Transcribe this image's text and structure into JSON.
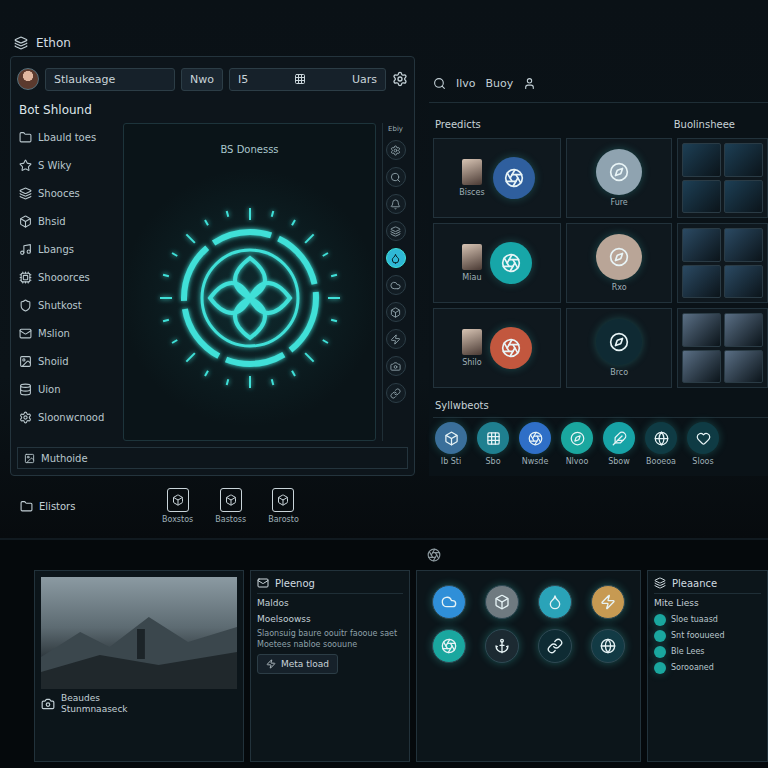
{
  "window": {
    "title": "Ethon"
  },
  "profile": {
    "name": "Stlaukeage",
    "button": "Nwo",
    "field": "I5",
    "user": "Uars"
  },
  "panel": {
    "title": "Bot Shlound",
    "badge": "BS Donesss",
    "status": "Muthoide"
  },
  "sidebar": {
    "items": [
      {
        "label": "Lbauld toes",
        "selected": false
      },
      {
        "label": "S Wiky",
        "selected": false
      },
      {
        "label": "Shooces",
        "selected": false
      },
      {
        "label": "Bhsid",
        "selected": false
      },
      {
        "label": "Lbangs",
        "selected": false
      },
      {
        "label": "Shooorces",
        "selected": false
      },
      {
        "label": "Shutkost",
        "selected": false
      },
      {
        "label": "Mslion",
        "selected": false
      },
      {
        "label": "Shoiid",
        "selected": false
      },
      {
        "label": "Uion",
        "selected": false
      },
      {
        "label": "Sloonwcnood",
        "selected": false
      }
    ]
  },
  "tool_strip": {
    "label": "Ebiy",
    "items": [
      {
        "selected": false
      },
      {
        "selected": false
      },
      {
        "selected": false
      },
      {
        "selected": false
      },
      {
        "selected": true
      },
      {
        "selected": false
      },
      {
        "selected": false
      },
      {
        "selected": false
      },
      {
        "selected": false
      },
      {
        "selected": false
      }
    ]
  },
  "launcher": {
    "title": "Elistors",
    "items": [
      "Boxstos",
      "Bastoss",
      "Barosto"
    ]
  },
  "topbar": {
    "items": [
      "Ilvo",
      "Buoy"
    ]
  },
  "sections": {
    "left": "Preedicts",
    "right": "Buolinsheee"
  },
  "cards": [
    {
      "kind": "thumb-circle",
      "label": "Bisces",
      "color": "#2f5f9e"
    },
    {
      "kind": "circle",
      "label": "Fure",
      "color": "#8fa3b0"
    },
    {
      "kind": "gallery",
      "color": "#1d3f55"
    },
    {
      "kind": "thumb-circle",
      "label": "Miau",
      "color": "#17a6a8"
    },
    {
      "kind": "circle",
      "label": "Rxo",
      "color": "#b9a597"
    },
    {
      "kind": "gallery",
      "color": "#2b4a63"
    },
    {
      "kind": "thumb-circle",
      "label": "Shilo",
      "color": "#c2573e"
    },
    {
      "kind": "circle",
      "label": "Brco",
      "color": "#0f2a33"
    },
    {
      "kind": "gallery",
      "color": "#5a6f85"
    }
  ],
  "shortcuts": {
    "title": "Syllwbeots",
    "items": [
      {
        "label": "Ib Sti",
        "color": "#3a6f9a"
      },
      {
        "label": "Sbo",
        "color": "#1f7f8f"
      },
      {
        "label": "Nwsde",
        "color": "#2f6fc7"
      },
      {
        "label": "Nlvoo",
        "color": "#1aa79f"
      },
      {
        "label": "Sbow",
        "color": "#17a3a6"
      },
      {
        "label": "Booeoa",
        "color": "#0f3b44"
      },
      {
        "label": "Sloos",
        "color": "#0f3b44"
      }
    ]
  },
  "media": {
    "caption": "Beaudes",
    "subcaption": "Stunmnaaseck"
  },
  "article": {
    "title": "Pleenog",
    "heading": "Maldos",
    "subheading": "Moelsoowss",
    "body": "Slaonsuig baure oouitr faooue saet Moetees nabloe soouune",
    "button": "Meta tload"
  },
  "apps": {
    "items": [
      {
        "color": "#2f8fd8"
      },
      {
        "color": "#6f7a80"
      },
      {
        "color": "#2aa3b8"
      },
      {
        "color": "#c79a52"
      },
      {
        "color": "#1aa79f"
      },
      {
        "color": "#1c2a32"
      },
      {
        "color": "#0e2b33"
      },
      {
        "color": "#123a44"
      }
    ]
  },
  "details": {
    "title": "Pleaance",
    "subtitle": "Mite Liess",
    "rows": [
      "Sloe tuaasd",
      "Snt foouueed",
      "Ble Lees",
      "Sorooaned"
    ]
  }
}
